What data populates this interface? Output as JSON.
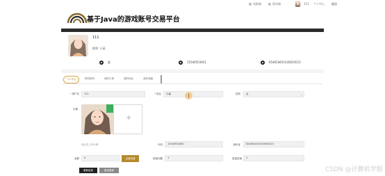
{
  "topbar": {
    "link1": "电脑端",
    "link2": "移动端",
    "username": "111",
    "personal_center": "个人中心",
    "logout": "退出"
  },
  "header": {
    "site_title": "基于Java的游戏账号交易平台"
  },
  "profile": {
    "name": "111",
    "nickname_line": "昵称: 小高",
    "gender": "女",
    "phone": "15546554651",
    "id_card": "654654651545654515"
  },
  "tabs": [
    {
      "label": "个人中心"
    },
    {
      "label": "修改密码"
    },
    {
      "label": "我的订单"
    },
    {
      "label": "我的地址"
    },
    {
      "label": "我的收藏"
    }
  ],
  "form": {
    "username_label": "用户名",
    "username_value": "111",
    "name_label": "姓名",
    "name_value": "小高",
    "gender_label": "性别",
    "gender_value": "女",
    "avatar_label": "头像",
    "avatar_hint": "请点击上传头像",
    "phone_label": "手机",
    "phone_value": "15546554651",
    "id_label": "身份证",
    "id_value": "654654651545654515",
    "balance_label": "余额",
    "balance_value": "0",
    "recharge_button": "点我充值",
    "question_label": "密保问题",
    "question_value": "1",
    "answer_label": "密保答案",
    "answer_value": "1",
    "update_button": "更新信息",
    "logout_button": "退出登录"
  },
  "watermark": "CSDN @计算机学姐"
}
